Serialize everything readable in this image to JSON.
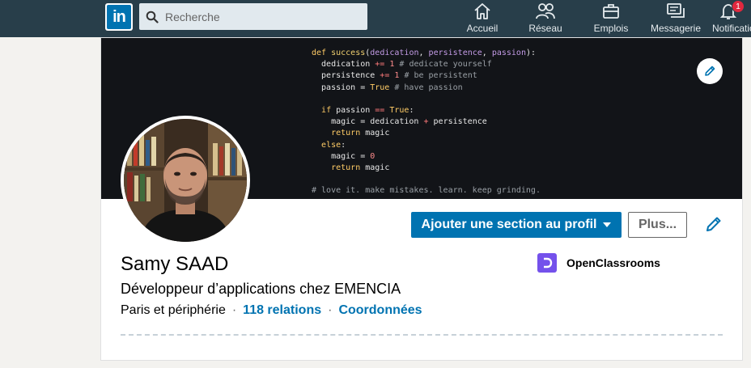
{
  "nav": {
    "logo_text": "in",
    "search_placeholder": "Recherche",
    "items": [
      {
        "label": "Accueil",
        "icon": "home-icon"
      },
      {
        "label": "Réseau",
        "icon": "network-icon"
      },
      {
        "label": "Emplois",
        "icon": "briefcase-icon"
      },
      {
        "label": "Messagerie",
        "icon": "messaging-icon"
      },
      {
        "label": "Notifications",
        "icon": "bell-icon",
        "badge": "1"
      }
    ],
    "colors": {
      "bar": "#283e4a",
      "brand": "#0073b1"
    }
  },
  "banner": {
    "code_lines": [
      "def success(dedication, persistence, passion):",
      "  dedication += 1 # dedicate yourself",
      "  persistence += 1 # be persistent",
      "  passion = True # have passion",
      "",
      "  if passion == True:",
      "    magic = dedication + persistence",
      "    return magic",
      "  else:",
      "    magic = 0",
      "    return magic",
      "",
      "# love it. make mistakes. learn. keep grinding."
    ]
  },
  "profile": {
    "name": "Samy SAAD",
    "headline": "Développeur d’applications chez EMENCIA",
    "location": "Paris et périphérie",
    "separator": "·",
    "connections": "118 relations",
    "contact": "Coordonnées",
    "company": "OpenClassrooms",
    "company_color": "#7451eb"
  },
  "actions": {
    "add_section": "Ajouter une section au profil",
    "more": "Plus..."
  }
}
